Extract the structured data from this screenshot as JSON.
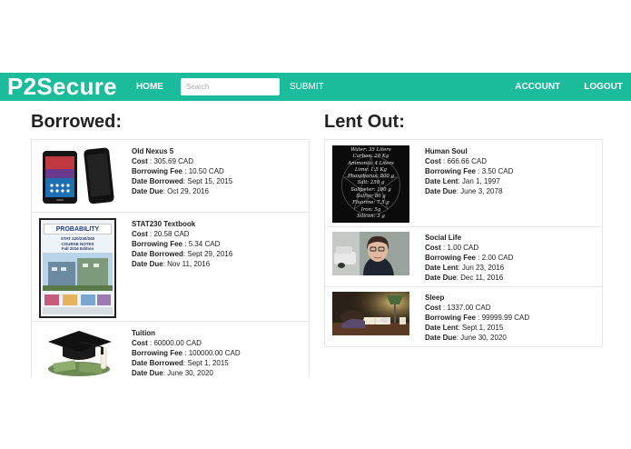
{
  "nav": {
    "brand": "P2Secure",
    "home": "HOME",
    "search_placeholder": "Search",
    "submit": "SUBMIT",
    "account": "ACCOUNT",
    "logout": "LOGOUT"
  },
  "borrowed": {
    "title": "Borrowed:",
    "items": [
      {
        "name": "Old Nexus 5",
        "cost_label": "Cost",
        "cost": "305.69 CAD",
        "fee_label": "Borrowing Fee",
        "fee": "10.50 CAD",
        "date1_label": "Date Borrowed",
        "date1": "Sept 15, 2015",
        "due_label": "Date Due",
        "due": "Oct 29, 2016"
      },
      {
        "name": "STAT230 Textbook",
        "cost_label": "Cost",
        "cost": "20.58 CAD",
        "fee_label": "Borrowing Fee",
        "fee": "5.34 CAD",
        "date1_label": "Date Borrowed",
        "date1": "Sept 29, 2016",
        "due_label": "Date Due",
        "due": "Nov 11, 2016",
        "cover": {
          "title": "PROBABILITY",
          "line1": "STAT 220/230/240",
          "line2": "COURSE NOTES",
          "line3": "Fall 2016 Edition"
        }
      },
      {
        "name": "Tuition",
        "cost_label": "Cost",
        "cost": "60000.00 CAD",
        "fee_label": "Borrowing Fee",
        "fee": "100000.00 CAD",
        "date1_label": "Date Borrowed",
        "date1": "Sept 1, 2015",
        "due_label": "Date Due",
        "due": "June 30, 2020"
      }
    ]
  },
  "lent": {
    "title": "Lent Out:",
    "items": [
      {
        "name": "Human Soul",
        "cost_label": "Cost",
        "cost": "666.66 CAD",
        "fee_label": "Borrowing Fee",
        "fee": "3.50 CAD",
        "date1_label": "Date Lent",
        "date1": "Jan 1, 1997",
        "due_label": "Date Due",
        "due": "June 3, 2078",
        "image_lines": [
          "Water: 35 Liters",
          "Carbon: 20 Kg",
          "Ammonia: 4 Liters",
          "Lime: 1.5 Kg",
          "Phosphorus: 800 g",
          "Salt: 250 g",
          "Saltpeter: 100 g",
          "Sulfur: 80 g",
          "Fluorine: 7.5 g",
          "Iron: 5g",
          "Silicon: 3 g"
        ]
      },
      {
        "name": "Social Life",
        "cost_label": "Cost",
        "cost": "1.00 CAD",
        "fee_label": "Borrowing Fee",
        "fee": "2.00 CAD",
        "date1_label": "Date Lent",
        "date1": "Jun 23, 2016",
        "due_label": "Date Due",
        "due": "Dec 11, 2016"
      },
      {
        "name": "Sleep",
        "cost_label": "Cost",
        "cost": "1337.00 CAD",
        "fee_label": "Borrowing Fee",
        "fee": "99999.99 CAD",
        "date1_label": "Date Lent",
        "date1": "Sept 1, 2015",
        "due_label": "Date Due",
        "due": "June 30, 2020"
      }
    ]
  }
}
